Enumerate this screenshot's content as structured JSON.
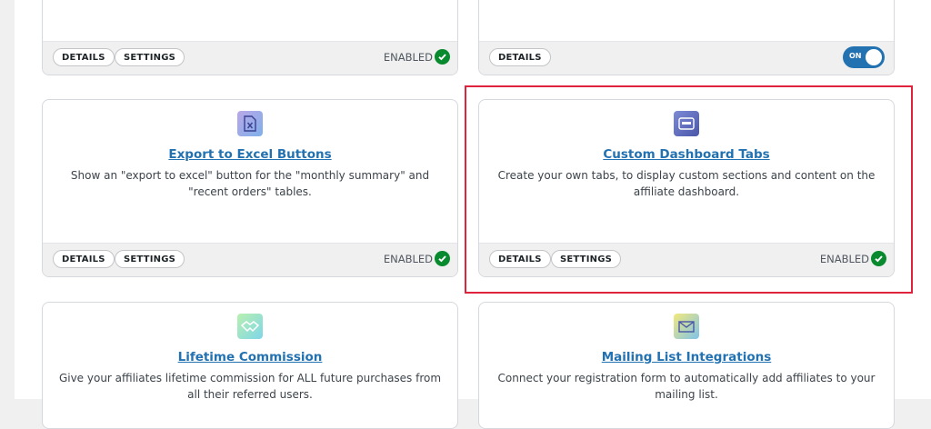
{
  "cards": {
    "top_left": {
      "details": "DETAILS",
      "settings": "SETTINGS",
      "status": "ENABLED"
    },
    "top_right": {
      "details": "DETAILS",
      "toggle_label": "ON"
    },
    "export_excel": {
      "title": "Export to Excel Buttons",
      "description": "Show an \"export to excel\" button for the \"monthly summary\" and \"recent orders\" tables.",
      "details": "DETAILS",
      "settings": "SETTINGS",
      "status": "ENABLED"
    },
    "custom_tabs": {
      "title": "Custom Dashboard Tabs",
      "description": "Create your own tabs, to display custom sections and content on the affiliate dashboard.",
      "details": "DETAILS",
      "settings": "SETTINGS",
      "status": "ENABLED"
    },
    "lifetime": {
      "title": "Lifetime Commission",
      "description": "Give your affiliates lifetime commission for ALL future purchases from all their referred users."
    },
    "mailing": {
      "title": "Mailing List Integrations",
      "description": "Connect your registration form to automatically add affiliates to your mailing list."
    }
  },
  "icons": {
    "export_excel": "excel-file-icon",
    "custom_tabs": "dashboard-window-icon",
    "lifetime": "handshake-icon",
    "mailing": "envelope-icon"
  },
  "colors": {
    "link": "#2271b1",
    "enabled_check": "#0a8a2e",
    "toggle_on": "#2271b1",
    "highlight": "#e0233c"
  }
}
